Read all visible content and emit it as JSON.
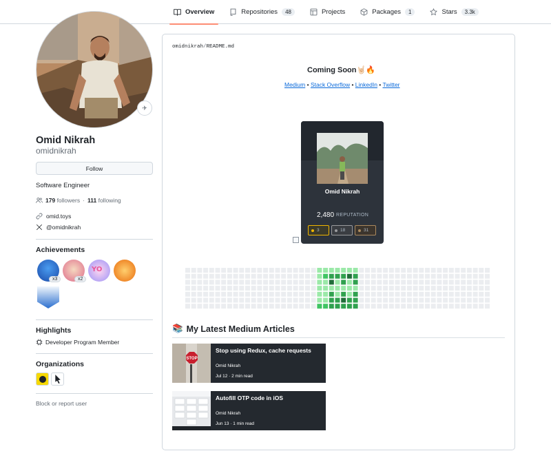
{
  "tabs": [
    {
      "label": "Overview",
      "count": null,
      "icon": "book-icon",
      "active": true
    },
    {
      "label": "Repositories",
      "count": "48",
      "icon": "repo-icon"
    },
    {
      "label": "Projects",
      "count": null,
      "icon": "table-icon"
    },
    {
      "label": "Packages",
      "count": "1",
      "icon": "package-icon"
    },
    {
      "label": "Stars",
      "count": "3.3k",
      "icon": "star-icon"
    }
  ],
  "profile": {
    "name": "Omid Nikrah",
    "login": "omidnikrah",
    "follow_label": "Follow",
    "bio": "Software Engineer",
    "followers_count": "179",
    "followers_label": "followers",
    "following_count": "111",
    "following_label": "following",
    "separator": "·",
    "website": "omid.toys",
    "twitter": "@omidnikrah"
  },
  "achievements": {
    "title": "Achievements",
    "items": [
      {
        "name": "pull-shark",
        "multiplier": "x3"
      },
      {
        "name": "pair-extraordinaire",
        "multiplier": "x2"
      },
      {
        "name": "yolo",
        "multiplier": null
      },
      {
        "name": "starstruck",
        "multiplier": null
      },
      {
        "name": "arctic-code-vault",
        "multiplier": null
      }
    ]
  },
  "highlights": {
    "title": "Highlights",
    "items": [
      "Developer Program Member"
    ]
  },
  "organizations": {
    "title": "Organizations"
  },
  "block_label": "Block or report user",
  "readme": {
    "owner": "omidnikrah",
    "slash": "/",
    "file": "README.md",
    "heading": "Coming Soon🤘🏻🔥",
    "links": [
      "Medium",
      "Stack Overflow",
      "LinkedIn",
      "Twitter"
    ],
    "link_separator": " • "
  },
  "stackoverflow_card": {
    "name": "Omid Nikrah",
    "reputation": "2,480",
    "reputation_label": "REPUTATION",
    "badges": [
      {
        "count": "3",
        "color": "#f1b600"
      },
      {
        "count": "18",
        "color": "#9a9b9e"
      },
      {
        "count": "31",
        "color": "#ab8a5f"
      }
    ]
  },
  "articles": {
    "title": "My Latest Medium Articles",
    "icon": "books-icon",
    "items": [
      {
        "title": "Stop using Redux, cache requests",
        "author": "Omid Nikrah",
        "meta": "Jul 12 · 2 min read"
      },
      {
        "title": "Autofill OTP code in iOS",
        "author": "Omid Nikrah",
        "meta": "Jun 13 · 1 min read"
      }
    ]
  },
  "colors": {
    "accent_underline": "#fd8c73",
    "link": "#0969da",
    "card_bg": "#2d333b",
    "article_bg": "#24292f",
    "grid_empty": "#ebedf0",
    "grid_green_light": "#9be9a8",
    "grid_green_mid": "#40c463",
    "grid_green_dark": "#30a14e",
    "grid_green_darkest": "#216e39"
  }
}
